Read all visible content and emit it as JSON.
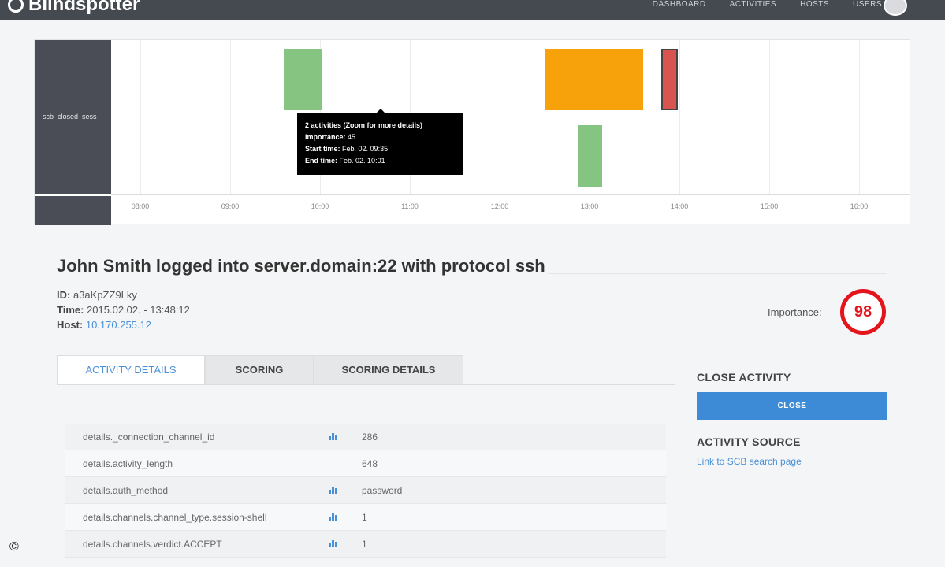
{
  "nav": {
    "brand": "Blindspotter",
    "items": [
      "DASHBOARD",
      "ACTIVITIES",
      "HOSTS",
      "USERS"
    ]
  },
  "timeline": {
    "row_label": "scb_closed_sess",
    "ticks": [
      "08:00",
      "09:00",
      "10:00",
      "11:00",
      "12:00",
      "13:00",
      "14:00",
      "15:00",
      "16:00"
    ],
    "bars": [
      {
        "start": 9.6,
        "end": 10.02,
        "lane": 0,
        "color": "#86c581"
      },
      {
        "start": 12.5,
        "end": 13.6,
        "lane": 0,
        "color": "#f7a20a"
      },
      {
        "start": 13.8,
        "end": 13.98,
        "lane": 0,
        "color": "#d9534f"
      },
      {
        "start": 12.87,
        "end": 13.14,
        "lane": 1,
        "color": "#86c581"
      }
    ],
    "tooltip": {
      "title": "2 activities (Zoom for more details)",
      "importance_label": "Importance:",
      "importance_value": "45",
      "start_label": "Start time:",
      "start_value": "Feb. 02. 09:35",
      "end_label": "End time:",
      "end_value": "Feb. 02. 10:01"
    }
  },
  "activity": {
    "title": "John Smith logged into server.domain:22 with protocol ssh",
    "id_label": "ID:",
    "id_value": "a3aKpZZ9Lky",
    "time_label": "Time:",
    "time_value": "2015.02.02. - 13:48:12",
    "host_label": "Host:",
    "host_value": "10.170.255.12",
    "importance_label": "Importance:",
    "importance_value": "98"
  },
  "tabs": [
    "ACTIVITY DETAILS",
    "SCORING",
    "SCORING DETAILS"
  ],
  "details": [
    {
      "key": "details._connection_channel_id",
      "icon": true,
      "value": "286"
    },
    {
      "key": "details.activity_length",
      "icon": false,
      "value": "648"
    },
    {
      "key": "details.auth_method",
      "icon": true,
      "value": "password"
    },
    {
      "key": "details.channels.channel_type.session-shell",
      "icon": true,
      "value": "1"
    },
    {
      "key": "details.channels.verdict.ACCEPT",
      "icon": true,
      "value": "1"
    }
  ],
  "side": {
    "close_title": "CLOSE ACTIVITY",
    "close_button": "CLOSE",
    "source_title": "ACTIVITY SOURCE",
    "source_link": "Link to SCB search page"
  },
  "copyright": "©",
  "colors": {
    "accent": "#3d8bd6",
    "importance": "#e3141b"
  }
}
